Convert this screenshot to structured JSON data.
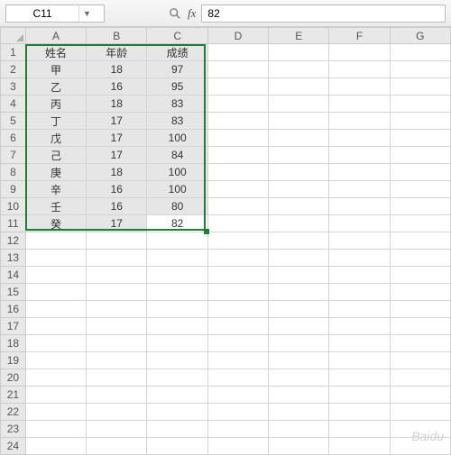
{
  "toolbar": {
    "name_box_value": "C11",
    "formula_value": "82"
  },
  "columns": [
    "A",
    "B",
    "C",
    "D",
    "E",
    "F",
    "G"
  ],
  "rows": [
    "1",
    "2",
    "3",
    "4",
    "5",
    "6",
    "7",
    "8",
    "9",
    "10",
    "11",
    "12",
    "13",
    "14",
    "15",
    "16",
    "17",
    "18",
    "19",
    "20",
    "21",
    "22",
    "23",
    "24"
  ],
  "grid": {
    "headers": {
      "A": "姓名",
      "B": "年龄",
      "C": "成绩"
    },
    "data": [
      {
        "A": "甲",
        "B": "18",
        "C": "97"
      },
      {
        "A": "乙",
        "B": "16",
        "C": "95"
      },
      {
        "A": "丙",
        "B": "18",
        "C": "83"
      },
      {
        "A": "丁",
        "B": "17",
        "C": "83"
      },
      {
        "A": "戊",
        "B": "17",
        "C": "100"
      },
      {
        "A": "己",
        "B": "17",
        "C": "84"
      },
      {
        "A": "庚",
        "B": "18",
        "C": "100"
      },
      {
        "A": "辛",
        "B": "16",
        "C": "100"
      },
      {
        "A": "壬",
        "B": "16",
        "C": "80"
      },
      {
        "A": "癸",
        "B": "17",
        "C": "82"
      }
    ]
  },
  "selection": {
    "active": "C11",
    "range": "A1:C11"
  },
  "watermark": "Baidu"
}
